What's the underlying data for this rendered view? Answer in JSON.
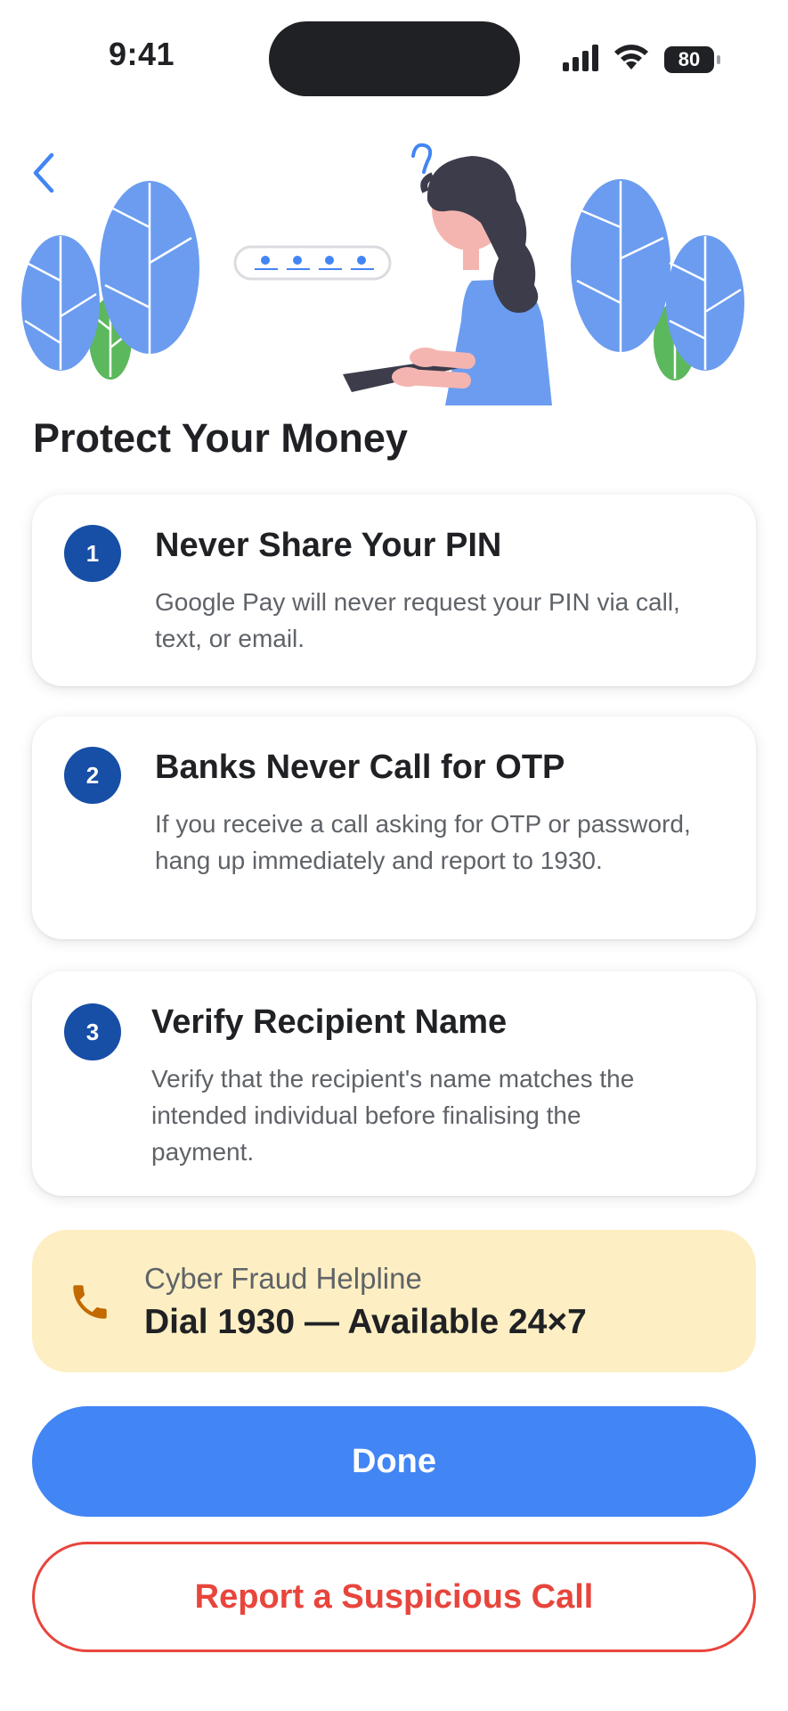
{
  "status_bar": {
    "time": "9:41",
    "battery": "80"
  },
  "page": {
    "title": "Protect Your Money"
  },
  "tips": [
    {
      "number": "1",
      "title": "Never Share Your PIN",
      "text": "Google Pay will never request your PIN via call, text, or email."
    },
    {
      "number": "2",
      "title": "Banks Never Call for OTP",
      "text": "If you receive a call asking for OTP or password, hang up immediately and report to 1930."
    },
    {
      "number": "3",
      "title": "Verify Recipient Name",
      "text": "Verify that the recipient's name matches the intended individual before finalising the payment."
    }
  ],
  "helpline": {
    "label": "Cyber Fraud Helpline",
    "value": "Dial 1930 — Available 24×7"
  },
  "actions": {
    "done_label": "Done",
    "report_label": "Report a Suspicious Call"
  },
  "icons": [
    "back-chevron-icon",
    "signal-icon",
    "wifi-icon",
    "battery-icon",
    "phone-icon"
  ],
  "colors": {
    "accent": "#4285f4",
    "number_badge": "#174ea6",
    "danger": "#e8453c",
    "helpline_bg": "#fdefc3",
    "leaf": "#6b9cf0",
    "leaf_green": "#5cb85c"
  }
}
